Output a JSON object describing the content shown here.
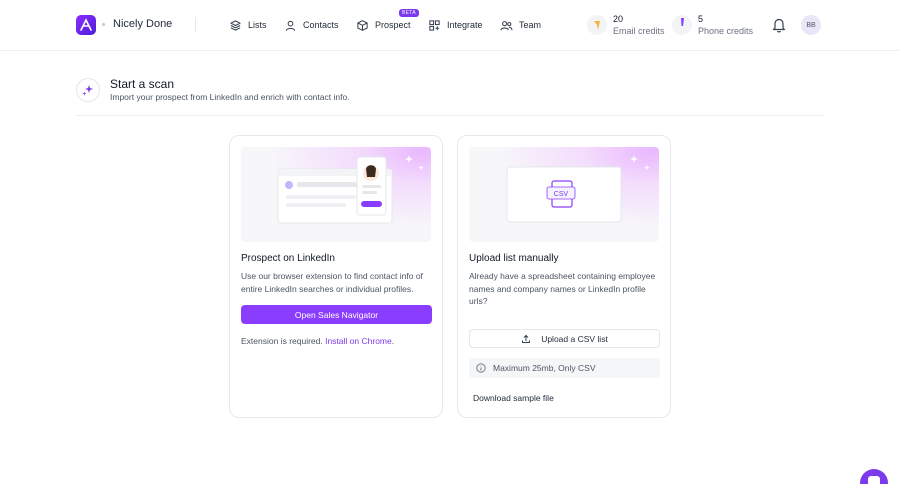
{
  "nav": {
    "workspace": "Nicely Done",
    "items": [
      {
        "label": "Lists",
        "icon": "stack-icon"
      },
      {
        "label": "Contacts",
        "icon": "user-icon"
      },
      {
        "label": "Prospect",
        "icon": "cube-icon",
        "badge": "BETA"
      },
      {
        "label": "Integrate",
        "icon": "grid-icon"
      },
      {
        "label": "Team",
        "icon": "users-icon"
      }
    ],
    "credits": [
      {
        "value": "20",
        "label": "Email credits",
        "color": "#f5b63a"
      },
      {
        "value": "5",
        "label": "Phone credits",
        "color": "#8b3dff"
      }
    ],
    "avatar": "BB"
  },
  "header": {
    "title": "Start a scan",
    "subtitle": "Import your prospect from LinkedIn and enrich with contact info."
  },
  "cards": {
    "linkedin": {
      "title": "Prospect on LinkedIn",
      "desc": "Use our browser extension to find contact info of entire LinkedIn searches or individual profiles.",
      "button": "Open Sales Navigator",
      "note_prefix": "Extension is required. ",
      "note_link": "Install on Chrome",
      "note_suffix": "."
    },
    "upload": {
      "title": "Upload list manually",
      "desc": "Already have a spreadsheet containing employee names and company names or LinkedIn profile urls?",
      "button": "Upload a CSV list",
      "info": "Maximum 25mb, Only CSV",
      "csv_label": "CSV",
      "download": "Download sample file"
    }
  },
  "colors": {
    "accent": "#8b3dff",
    "link": "#7c3aed"
  }
}
